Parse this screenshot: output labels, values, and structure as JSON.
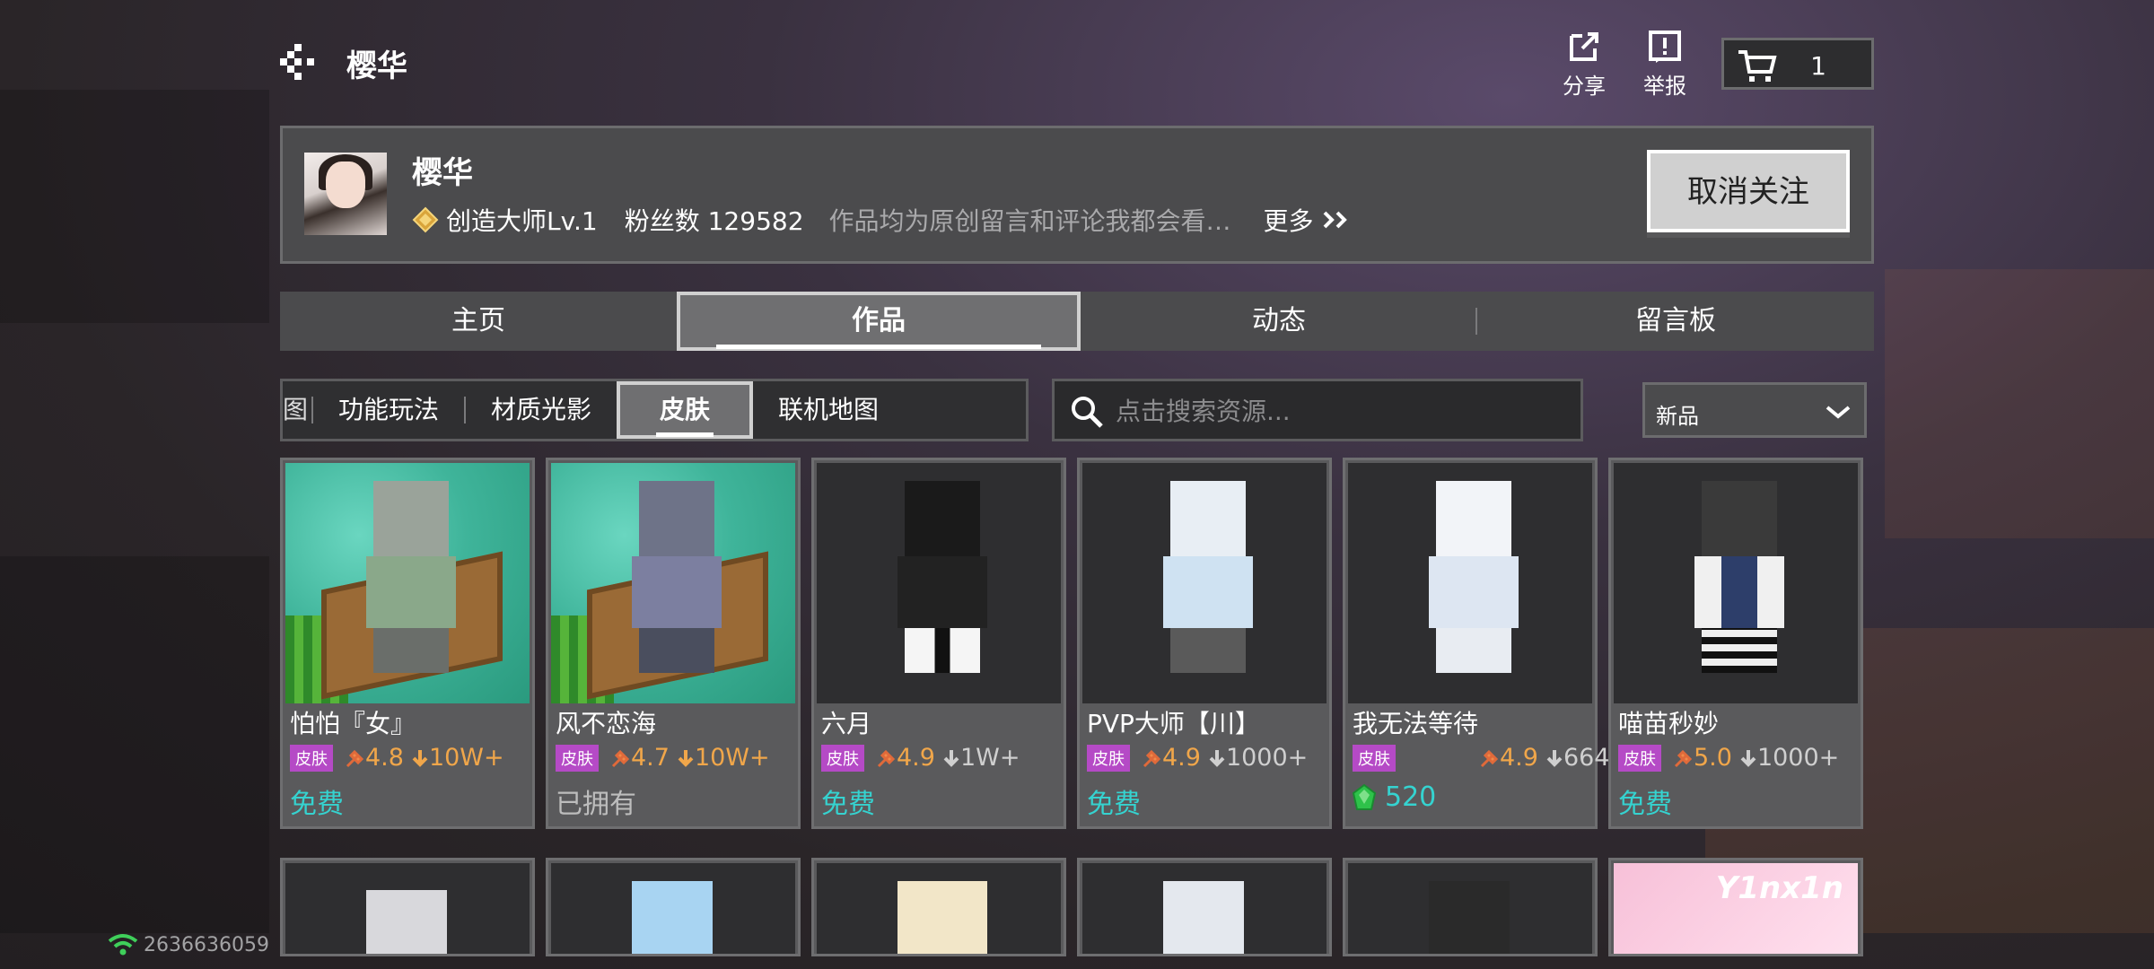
{
  "header": {
    "title": "樱华",
    "share_label": "分享",
    "report_label": "举报",
    "cart_count": "1"
  },
  "profile": {
    "name": "樱华",
    "level": "创造大师Lv.1",
    "fans": "粉丝数 129582",
    "bio": "作品均为原创留言和评论我都会看…",
    "more": "更多",
    "unfollow_label": "取消关注"
  },
  "tabs": [
    {
      "label": "主页",
      "active": false
    },
    {
      "label": "作品",
      "active": true
    },
    {
      "label": "动态",
      "active": false
    },
    {
      "label": "留言板",
      "active": false
    }
  ],
  "categories": [
    {
      "label": "图",
      "active": false
    },
    {
      "label": "功能玩法",
      "active": false
    },
    {
      "label": "材质光影",
      "active": false
    },
    {
      "label": "皮肤",
      "active": true
    },
    {
      "label": "联机地图",
      "active": false
    }
  ],
  "search": {
    "placeholder": "点击搜索资源..."
  },
  "sort": {
    "selected": "新品"
  },
  "items": [
    {
      "name": "怕怕『女』",
      "tag": "皮肤",
      "rating": "4.8",
      "downloads": "10W+",
      "price": "免费",
      "owned": false
    },
    {
      "name": "风不恋海",
      "tag": "皮肤",
      "rating": "4.7",
      "downloads": "10W+",
      "price": "已拥有",
      "owned": true
    },
    {
      "name": "六月",
      "tag": "皮肤",
      "rating": "4.9",
      "downloads": "1W+",
      "price": "免费",
      "owned": false
    },
    {
      "name": "PVP大师【川】",
      "tag": "皮肤",
      "rating": "4.9",
      "downloads": "1000+",
      "price": "免费",
      "owned": false
    },
    {
      "name": "我无法等待",
      "tag": "皮肤",
      "rating": "4.9",
      "downloads": "664",
      "price": "520",
      "owned": false
    },
    {
      "name": "喵苗秒妙",
      "tag": "皮肤",
      "rating": "5.0",
      "downloads": "1000+",
      "price": "免费",
      "owned": false
    }
  ],
  "second_row_thumb_text": "Y1nx1n",
  "status": {
    "network_id": "2636636059"
  },
  "colors": {
    "accent": "#35d3d0",
    "rating": "#f0a64a",
    "tag": "#b54ac6"
  }
}
